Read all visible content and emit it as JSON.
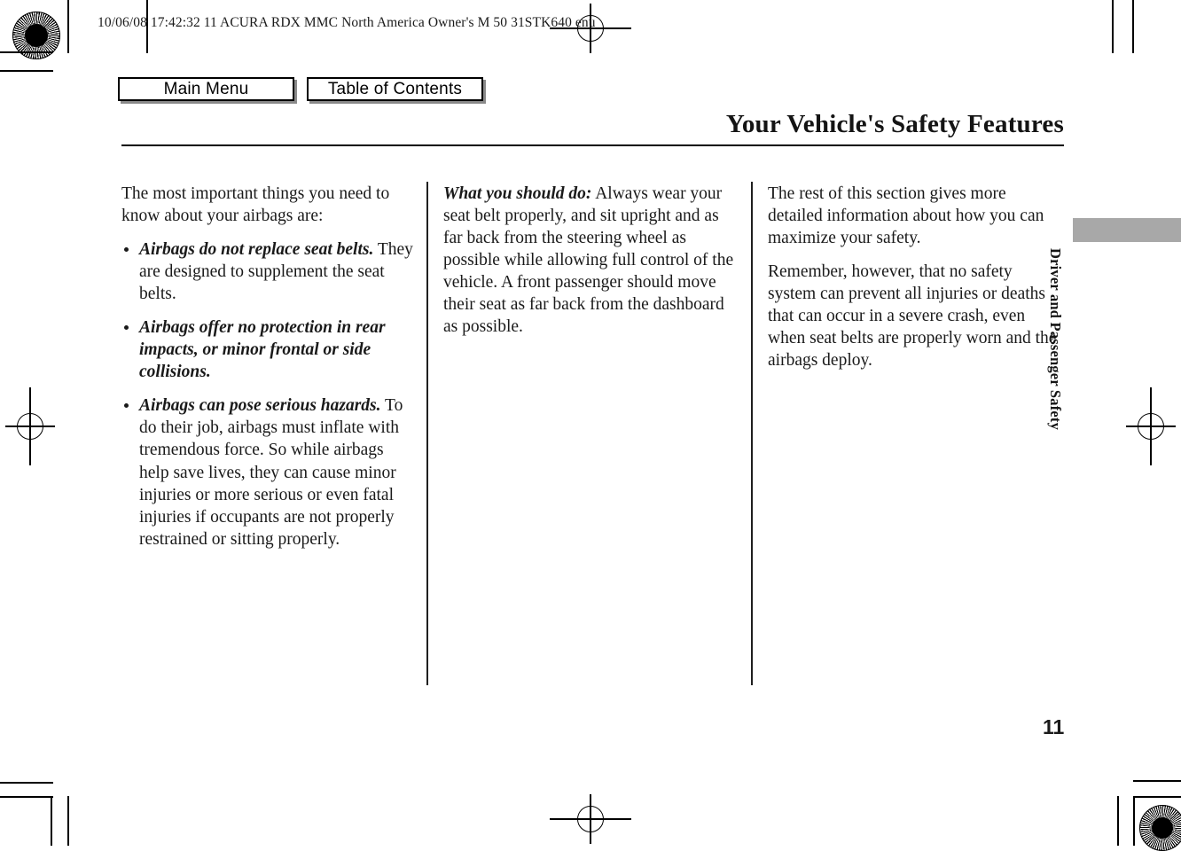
{
  "header": {
    "print_info": "10/06/08 17:42:32   11 ACURA RDX MMC North America Owner's M 50 31STK640 enu"
  },
  "nav": {
    "main_menu_label": "Main Menu",
    "table_of_contents_label": "Table of Contents"
  },
  "title": {
    "text": "Your Vehicle's Safety Features"
  },
  "side_tab": {
    "label": "Driver and Passenger Safety",
    "bar_color": "#a8a8a8"
  },
  "footer": {
    "page_number": "11"
  },
  "columns": {
    "one": {
      "intro": "The most important things you need to know about your airbags are:",
      "bullets": [
        {
          "lead": "Airbags do not replace seat belts.",
          "body": " They are designed to supplement the seat belts."
        },
        {
          "lead": "Airbags offer no protection in rear impacts, or minor frontal or side collisions.",
          "body": ""
        },
        {
          "lead": "Airbags can pose serious hazards.",
          "body": " To do their job, airbags must inflate with tremendous force. So while airbags help save lives, they can cause minor injuries or more serious or even fatal injuries if occupants are not properly restrained or sitting properly."
        }
      ]
    },
    "two": {
      "lead": "What you should do:",
      "body": " Always wear your seat belt properly, and sit upright and as far back from the steering wheel as possible while allowing full control of the vehicle. A front passenger should move their seat as far back from the dashboard as possible."
    },
    "three": {
      "para_1": "The rest of this section gives more detailed information about how you can maximize your safety.",
      "para_2": "Remember, however, that no safety system can prevent all injuries or deaths that can occur in a severe crash, even when seat belts are properly worn and the airbags deploy."
    }
  }
}
